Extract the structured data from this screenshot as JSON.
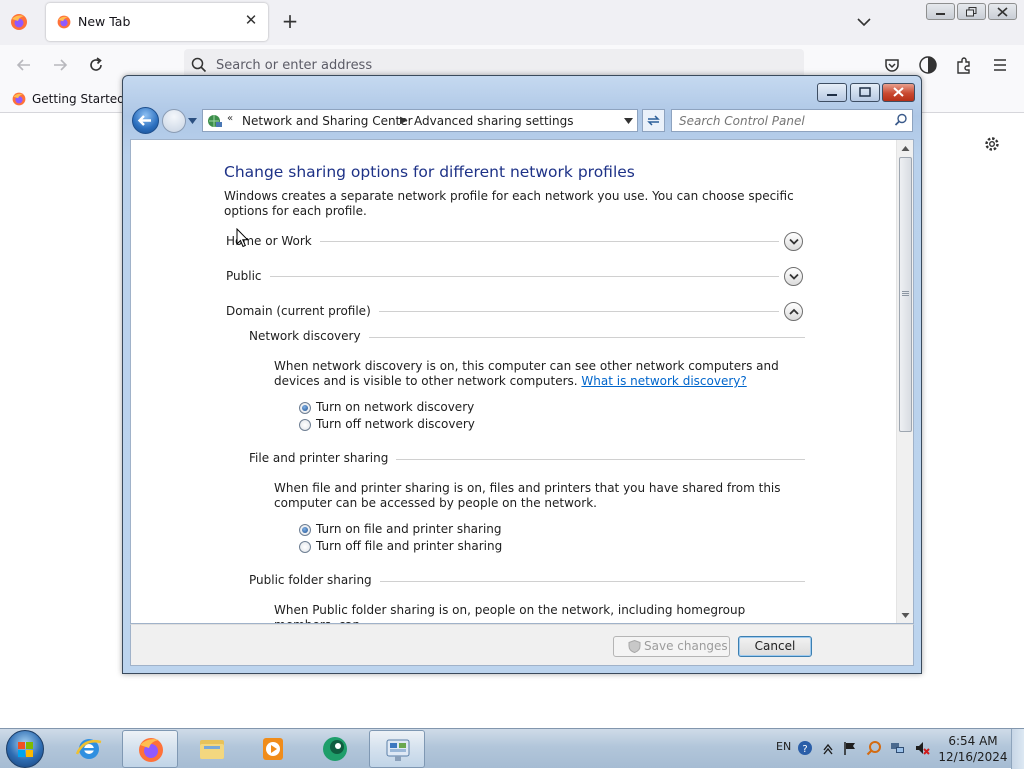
{
  "browser": {
    "tab_title": "New Tab",
    "url_placeholder": "Search or enter address",
    "bookmark": "Getting Started"
  },
  "window": {
    "address": {
      "overflow": "«",
      "crumb1": "Network and Sharing Center",
      "crumb2": "Advanced sharing settings"
    },
    "search_placeholder": "Search Control Panel",
    "heading": "Change sharing options for different network profiles",
    "intro": "Windows creates a separate network profile for each network you use. You can choose specific options for each profile.",
    "profiles": [
      {
        "name": "Home or Work",
        "state": "collapsed"
      },
      {
        "name": "Public",
        "state": "collapsed"
      },
      {
        "name": "Domain (current profile)",
        "state": "expanded"
      }
    ],
    "sections": {
      "network_discovery": {
        "title": "Network discovery",
        "desc": "When network discovery is on, this computer can see other network computers and devices and is visible to other network computers.",
        "link": "What is network discovery?",
        "options": [
          {
            "label": "Turn on network discovery",
            "selected": true
          },
          {
            "label": "Turn off network discovery",
            "selected": false
          }
        ]
      },
      "file_printer": {
        "title": "File and printer sharing",
        "desc": "When file and printer sharing is on, files and printers that you have shared from this computer can be accessed by people on the network.",
        "options": [
          {
            "label": "Turn on file and printer sharing",
            "selected": true
          },
          {
            "label": "Turn off file and printer sharing",
            "selected": false
          }
        ]
      },
      "public_folder": {
        "title": "Public folder sharing",
        "desc": "When Public folder sharing is on, people on the network, including homegroup members, can"
      }
    },
    "buttons": {
      "save": "Save changes",
      "cancel": "Cancel"
    }
  },
  "taskbar": {
    "language": "EN",
    "time": "6:54 AM",
    "date": "12/16/2024",
    "apps": [
      "internet-explorer",
      "firefox",
      "file-explorer",
      "media-player",
      "network-app",
      "control-panel"
    ]
  },
  "colors": {
    "heading": "#1e3287",
    "link": "#0066cc",
    "window_frame": "#b9d1ec",
    "taskbar": "#b2c6da"
  }
}
